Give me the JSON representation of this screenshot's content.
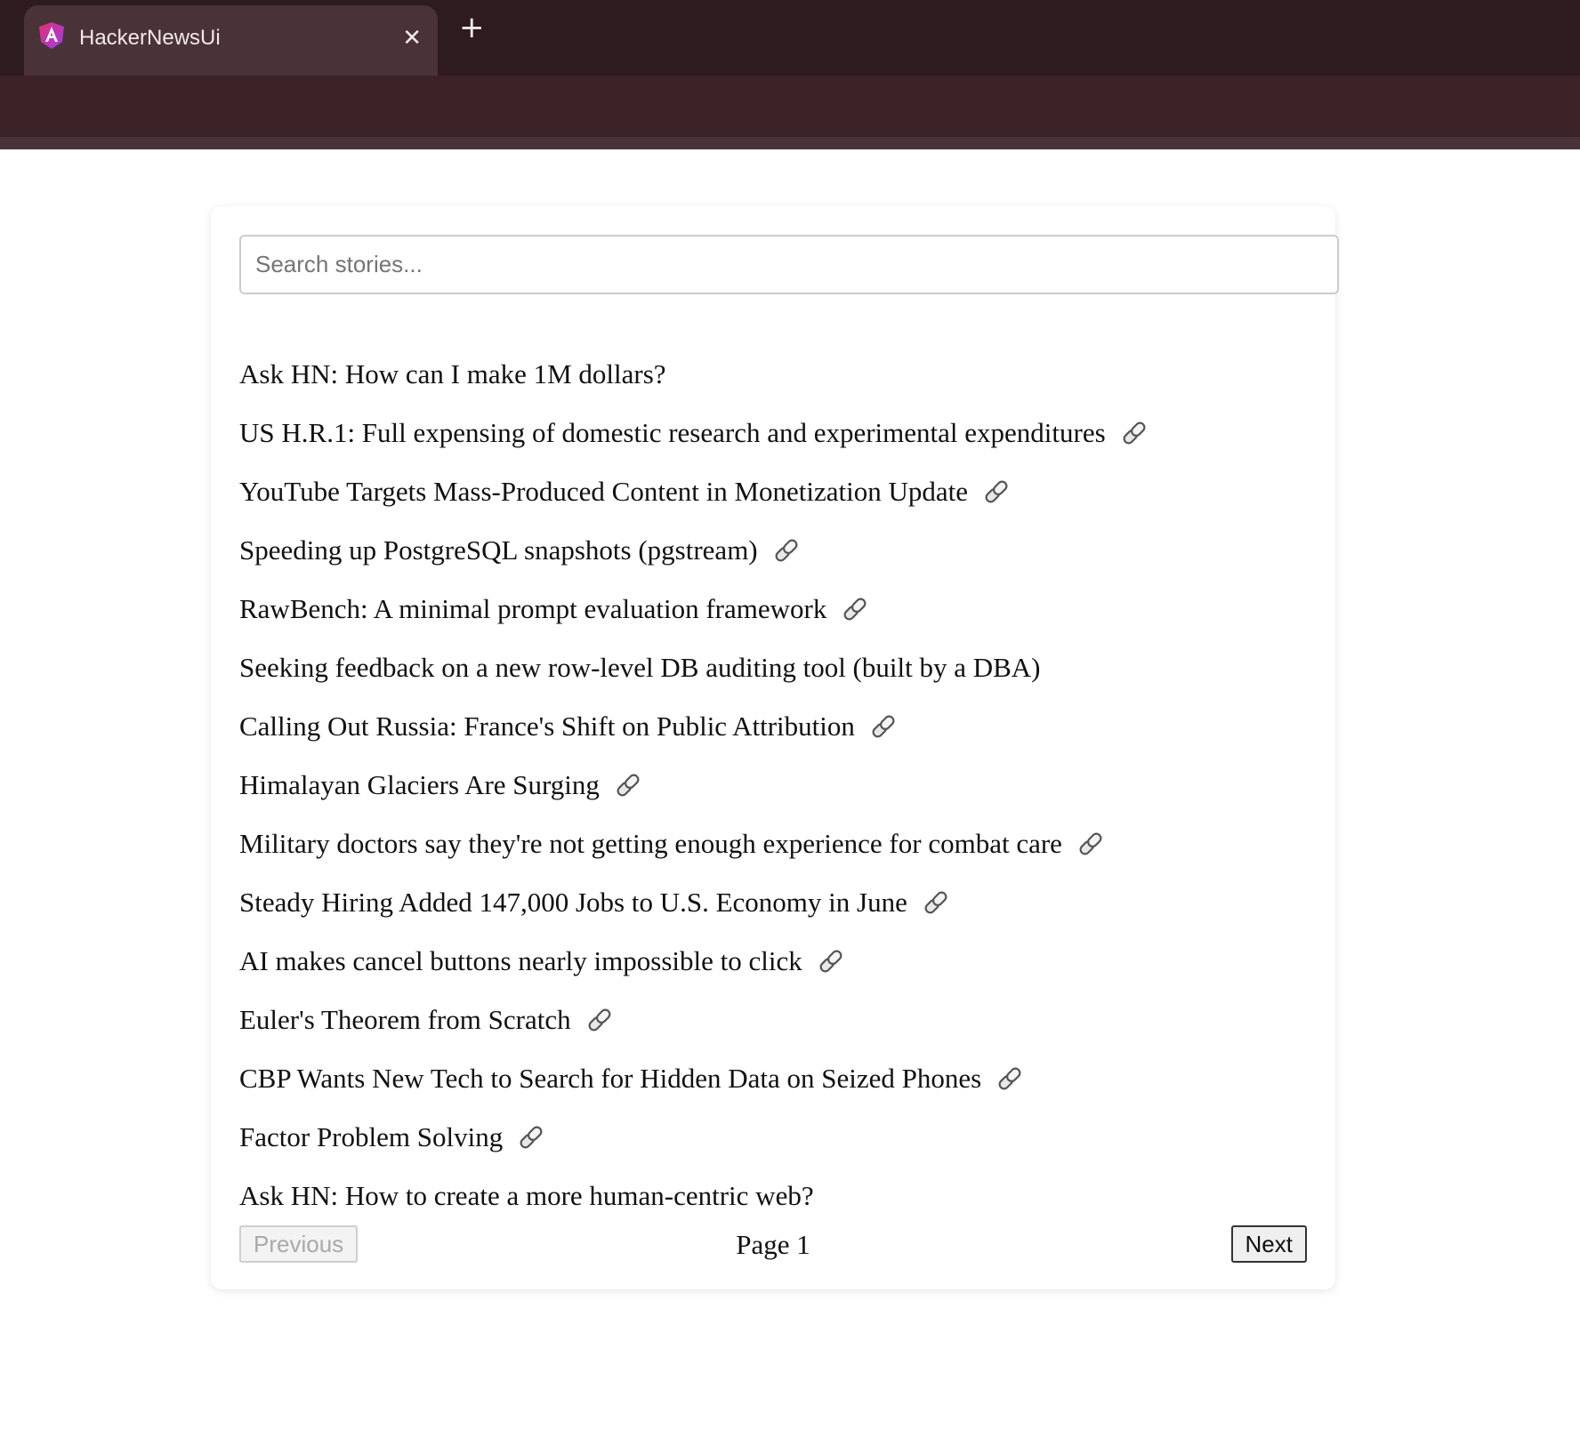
{
  "browser": {
    "tab_title": "HackerNewsUi",
    "close_glyph": "✕",
    "new_tab_glyph": "+"
  },
  "search": {
    "placeholder": "Search stories...",
    "value": ""
  },
  "stories": [
    {
      "title": "Ask HN: How can I make 1M dollars?",
      "has_link": false
    },
    {
      "title": "US H.R.1: Full expensing of domestic research and experimental expenditures",
      "has_link": true
    },
    {
      "title": "YouTube Targets Mass-Produced Content in Monetization Update",
      "has_link": true
    },
    {
      "title": "Speeding up PostgreSQL snapshots (pgstream)",
      "has_link": true
    },
    {
      "title": "RawBench: A minimal prompt evaluation framework",
      "has_link": true
    },
    {
      "title": "Seeking feedback on a new row-level DB auditing tool (built by a DBA)",
      "has_link": false
    },
    {
      "title": "Calling Out Russia: France's Shift on Public Attribution",
      "has_link": true
    },
    {
      "title": "Himalayan Glaciers Are Surging",
      "has_link": true
    },
    {
      "title": "Military doctors say they're not getting enough experience for combat care",
      "has_link": true
    },
    {
      "title": "Steady Hiring Added 147,000 Jobs to U.S. Economy in June",
      "has_link": true
    },
    {
      "title": "AI makes cancel buttons nearly impossible to click",
      "has_link": true
    },
    {
      "title": "Euler's Theorem from Scratch",
      "has_link": true
    },
    {
      "title": "CBP Wants New Tech to Search for Hidden Data on Seized Phones",
      "has_link": true
    },
    {
      "title": "Factor Problem Solving",
      "has_link": true
    },
    {
      "title": "Ask HN: How to create a more human-centric web?",
      "has_link": false
    }
  ],
  "pagination": {
    "previous_label": "Previous",
    "next_label": "Next",
    "page_label": "Page 1",
    "previous_disabled": true
  },
  "icons": {
    "link": "link-icon",
    "app_logo": "angular-logo-icon"
  },
  "colors": {
    "tabbar_bg": "#2e1b1f",
    "active_tab_bg": "#4a3338",
    "toolbar_bg": "#3a2227",
    "logo_primary": "#e0306e",
    "logo_secondary": "#a03cf0"
  }
}
